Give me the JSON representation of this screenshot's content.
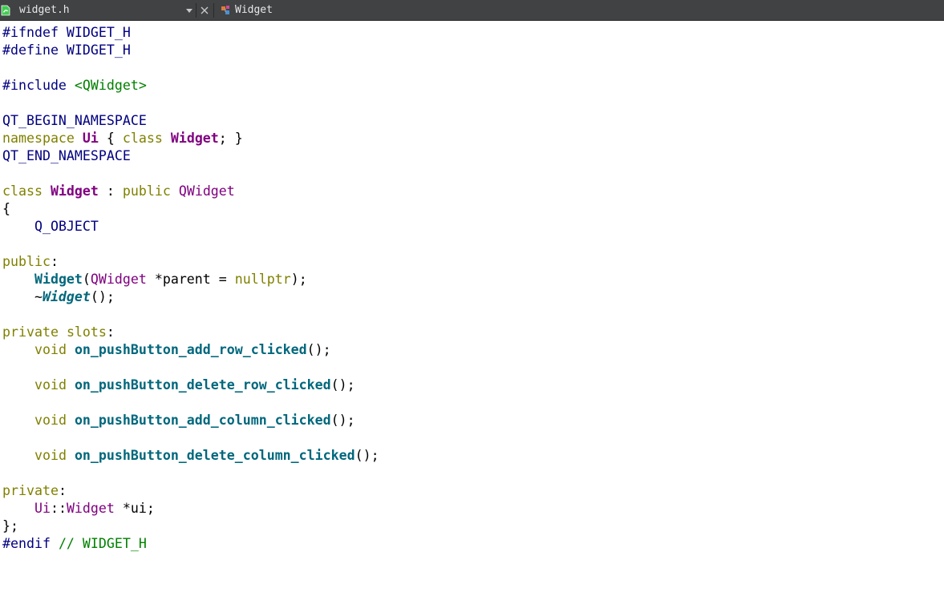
{
  "toolbar": {
    "file_name": "widget.h",
    "symbol_name": "Widget"
  },
  "colors": {
    "toolbar_bg": "#404244",
    "preprocessor": "#000080",
    "keyword": "#808000",
    "type": "#800080",
    "function": "#00677c",
    "string": "#008000",
    "comment": "#008000"
  },
  "icons": {
    "file_icon": "qt-header-file-icon",
    "dropdown": "chevron-down-icon",
    "close": "close-icon",
    "class": "class-symbol-icon"
  },
  "code": [
    [
      {
        "t": "pp",
        "v": "#ifndef WIDGET_H"
      }
    ],
    [
      {
        "t": "pp",
        "v": "#define WIDGET_H"
      }
    ],
    [],
    [
      {
        "t": "pp",
        "v": "#include "
      },
      {
        "t": "str",
        "v": "<QWidget>"
      }
    ],
    [],
    [
      {
        "t": "mac",
        "v": "QT_BEGIN_NAMESPACE"
      }
    ],
    [
      {
        "t": "kw",
        "v": "namespace"
      },
      {
        "t": "pl",
        "v": " "
      },
      {
        "t": "ty-b",
        "v": "Ui"
      },
      {
        "t": "pl",
        "v": " { "
      },
      {
        "t": "kw",
        "v": "class"
      },
      {
        "t": "pl",
        "v": " "
      },
      {
        "t": "ty-b",
        "v": "Widget"
      },
      {
        "t": "pl",
        "v": "; }"
      }
    ],
    [
      {
        "t": "mac",
        "v": "QT_END_NAMESPACE"
      }
    ],
    [],
    [
      {
        "t": "kw",
        "v": "class"
      },
      {
        "t": "pl",
        "v": " "
      },
      {
        "t": "ty-b",
        "v": "Widget"
      },
      {
        "t": "pl",
        "v": " : "
      },
      {
        "t": "kw",
        "v": "public"
      },
      {
        "t": "pl",
        "v": " "
      },
      {
        "t": "ty",
        "v": "QWidget"
      }
    ],
    [
      {
        "t": "pl",
        "v": "{"
      }
    ],
    [
      {
        "t": "pl",
        "v": "    "
      },
      {
        "t": "mac",
        "v": "Q_OBJECT"
      }
    ],
    [],
    [
      {
        "t": "kw",
        "v": "public"
      },
      {
        "t": "pl",
        "v": ":"
      }
    ],
    [
      {
        "t": "pl",
        "v": "    "
      },
      {
        "t": "fn-b",
        "v": "Widget"
      },
      {
        "t": "pl",
        "v": "("
      },
      {
        "t": "ty",
        "v": "QWidget"
      },
      {
        "t": "pl",
        "v": " *parent = "
      },
      {
        "t": "kw",
        "v": "nullptr"
      },
      {
        "t": "pl",
        "v": ");"
      }
    ],
    [
      {
        "t": "pl",
        "v": "    ~"
      },
      {
        "t": "fn-bi",
        "v": "Widget"
      },
      {
        "t": "pl",
        "v": "();"
      }
    ],
    [],
    [
      {
        "t": "kw",
        "v": "private"
      },
      {
        "t": "pl",
        "v": " "
      },
      {
        "t": "kw",
        "v": "slots"
      },
      {
        "t": "pl",
        "v": ":"
      }
    ],
    [
      {
        "t": "pl",
        "v": "    "
      },
      {
        "t": "kw",
        "v": "void"
      },
      {
        "t": "pl",
        "v": " "
      },
      {
        "t": "fn-b",
        "v": "on_pushButton_add_row_clicked"
      },
      {
        "t": "pl",
        "v": "();"
      }
    ],
    [],
    [
      {
        "t": "pl",
        "v": "    "
      },
      {
        "t": "kw",
        "v": "void"
      },
      {
        "t": "pl",
        "v": " "
      },
      {
        "t": "fn-b",
        "v": "on_pushButton_delete_row_clicked"
      },
      {
        "t": "pl",
        "v": "();"
      }
    ],
    [],
    [
      {
        "t": "pl",
        "v": "    "
      },
      {
        "t": "kw",
        "v": "void"
      },
      {
        "t": "pl",
        "v": " "
      },
      {
        "t": "fn-b",
        "v": "on_pushButton_add_column_clicked"
      },
      {
        "t": "pl",
        "v": "();"
      }
    ],
    [],
    [
      {
        "t": "pl",
        "v": "    "
      },
      {
        "t": "kw",
        "v": "void"
      },
      {
        "t": "pl",
        "v": " "
      },
      {
        "t": "fn-b",
        "v": "on_pushButton_delete_column_clicked"
      },
      {
        "t": "pl",
        "v": "();"
      }
    ],
    [],
    [
      {
        "t": "kw",
        "v": "private"
      },
      {
        "t": "pl",
        "v": ":"
      }
    ],
    [
      {
        "t": "pl",
        "v": "    "
      },
      {
        "t": "ty",
        "v": "Ui"
      },
      {
        "t": "pl",
        "v": "::"
      },
      {
        "t": "ty",
        "v": "Widget"
      },
      {
        "t": "pl",
        "v": " *ui;"
      }
    ],
    [
      {
        "t": "pl",
        "v": "};"
      }
    ],
    [
      {
        "t": "pp",
        "v": "#endif "
      },
      {
        "t": "cm",
        "v": "// WIDGET_H"
      }
    ]
  ]
}
